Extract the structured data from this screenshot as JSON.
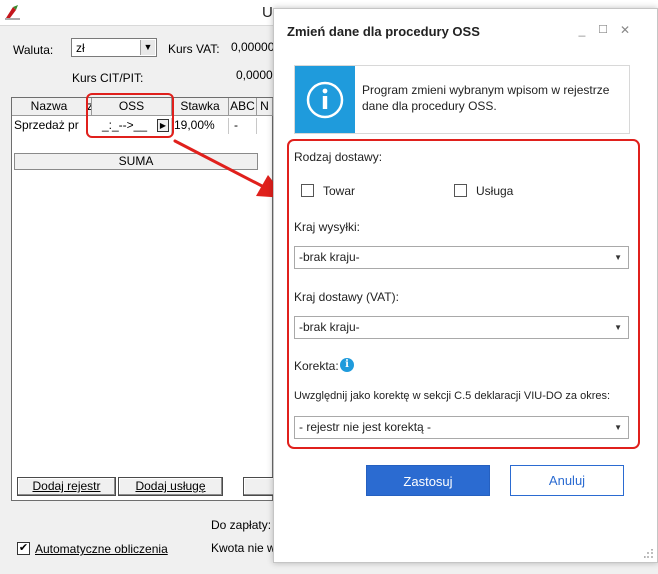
{
  "background": {
    "title_fragment": "U",
    "currency_label": "Waluta:",
    "currency_value": "zł",
    "vat_rate_label": "Kurs VAT:",
    "vat_rate_value": "0,00000",
    "cit_rate_label": "Kurs CIT/PIT:",
    "cit_rate_value": "0,00000",
    "grid": {
      "headers": [
        "Nazwa",
        "z",
        "OSS",
        "Stawka",
        "ABC",
        "N"
      ],
      "row": {
        "nazwa": "Sprzedaż pr",
        "oss": "_:_-->__",
        "stawka": "19,00%",
        "abc": "-"
      },
      "sum_label": "SUMA"
    },
    "buttons": {
      "add_register": "Dodaj rejestr",
      "add_service": "Dodaj usługę"
    },
    "to_pay_label": "Do zapłaty:",
    "amount_label": "Kwota nie wo",
    "auto_calc_label": "Automatyczne obliczenia",
    "auto_calc_checked": "✔"
  },
  "dialog": {
    "title": "Zmień dane dla procedury OSS",
    "window_controls": {
      "minimize": "_",
      "maximize": "☐",
      "close": "✕"
    },
    "info_text": "Program zmieni wybranym wpisom w rejestrze dane dla procedury OSS.",
    "delivery_type_label": "Rodzaj dostawy:",
    "goods_label": "Towar",
    "service_label": "Usługa",
    "shipping_country_label": "Kraj wysyłki:",
    "shipping_country_value": "-brak kraju-",
    "delivery_country_label": "Kraj dostawy (VAT):",
    "delivery_country_value": "-brak kraju-",
    "correction_label": "Korekta:",
    "correction_desc": "Uwzględnij jako korektę w sekcji C.5 deklaracji VIU-DO za okres:",
    "correction_value": "- rejestr nie jest korektą -",
    "apply_label": "Zastosuj",
    "cancel_label": "Anuluj"
  },
  "colors": {
    "accent_blue": "#2b6bd1",
    "info_blue": "#1f9bdc",
    "highlight_red": "#e0201c"
  },
  "icons": [
    "app-icon",
    "info-icon",
    "info-small-icon",
    "dropdown-caret-icon",
    "arrow-annotation-icon"
  ]
}
